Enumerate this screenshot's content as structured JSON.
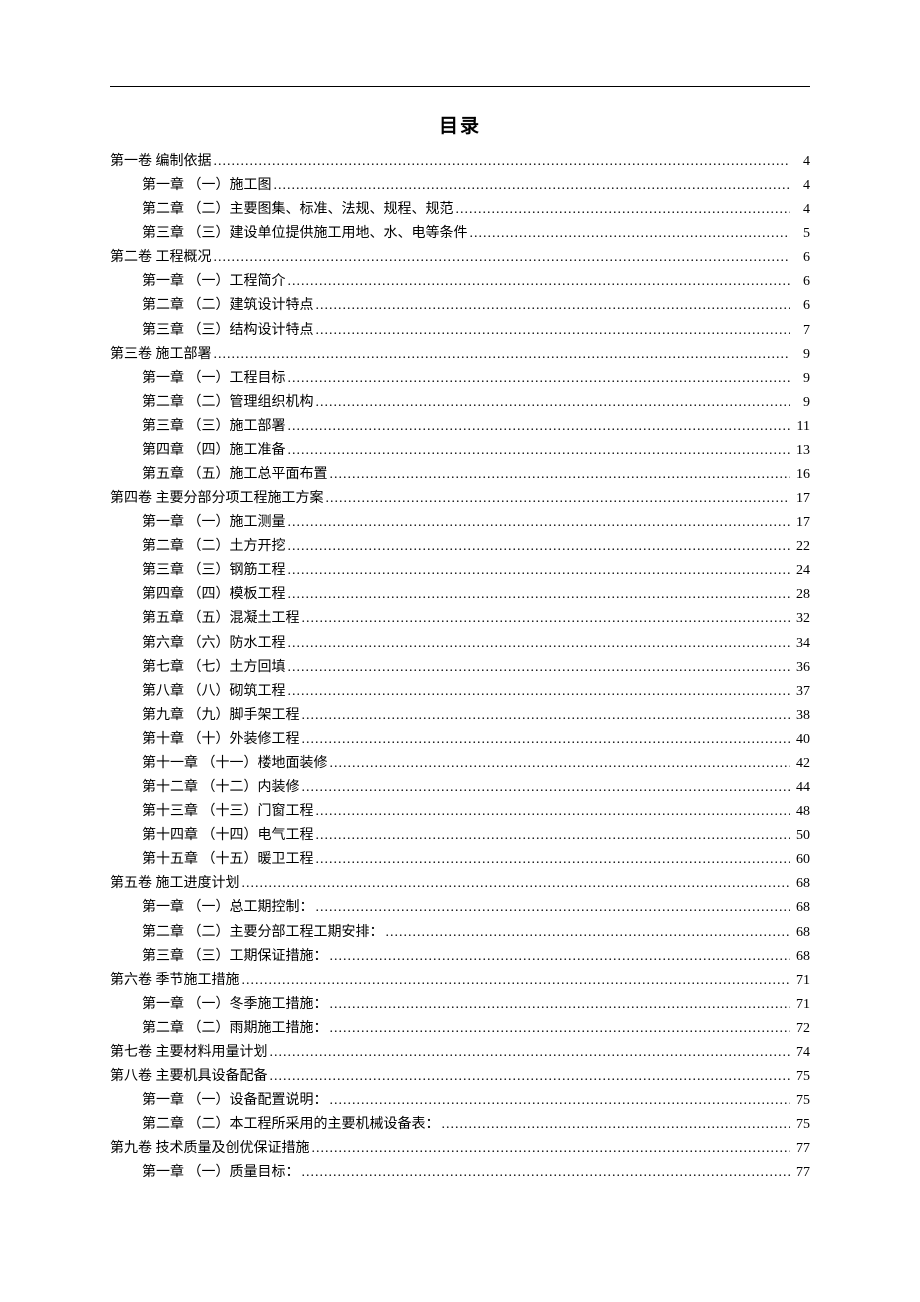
{
  "title": "目录",
  "entries": [
    {
      "level": 0,
      "label": "第一卷 编制依据",
      "page": "4"
    },
    {
      "level": 1,
      "label": "第一章 （一）施工图",
      "page": "4"
    },
    {
      "level": 1,
      "label": "第二章 （二）主要图集、标准、法规、规程、规范",
      "page": "4"
    },
    {
      "level": 1,
      "label": "第三章 （三）建设单位提供施工用地、水、电等条件",
      "page": "5"
    },
    {
      "level": 0,
      "label": "第二卷 工程概况",
      "page": "6"
    },
    {
      "level": 1,
      "label": "第一章 （一）工程简介",
      "page": "6"
    },
    {
      "level": 1,
      "label": "第二章 （二）建筑设计特点",
      "page": "6"
    },
    {
      "level": 1,
      "label": "第三章 （三）结构设计特点",
      "page": "7"
    },
    {
      "level": 0,
      "label": "第三卷 施工部署",
      "page": "9"
    },
    {
      "level": 1,
      "label": "第一章 （一）工程目标",
      "page": "9"
    },
    {
      "level": 1,
      "label": "第二章 （二）管理组织机构",
      "page": "9"
    },
    {
      "level": 1,
      "label": "第三章 （三）施工部署",
      "page": "11"
    },
    {
      "level": 1,
      "label": "第四章 （四）施工准备",
      "page": "13"
    },
    {
      "level": 1,
      "label": "第五章 （五）施工总平面布置",
      "page": "16"
    },
    {
      "level": 0,
      "label": "第四卷 主要分部分项工程施工方案",
      "page": "17"
    },
    {
      "level": 1,
      "label": "第一章 （一）施工测量",
      "page": "17"
    },
    {
      "level": 1,
      "label": "第二章 （二）土方开挖",
      "page": "22"
    },
    {
      "level": 1,
      "label": "第三章 （三）钢筋工程",
      "page": "24"
    },
    {
      "level": 1,
      "label": "第四章 （四）模板工程",
      "page": "28"
    },
    {
      "level": 1,
      "label": "第五章 （五）混凝土工程",
      "page": "32"
    },
    {
      "level": 1,
      "label": "第六章 （六）防水工程",
      "page": "34"
    },
    {
      "level": 1,
      "label": "第七章 （七）土方回填",
      "page": "36"
    },
    {
      "level": 1,
      "label": "第八章 （八）砌筑工程",
      "page": "37"
    },
    {
      "level": 1,
      "label": "第九章 （九）脚手架工程",
      "page": "38"
    },
    {
      "level": 1,
      "label": "第十章 （十）外装修工程",
      "page": "40"
    },
    {
      "level": 1,
      "label": "第十一章 （十一）楼地面装修",
      "page": "42"
    },
    {
      "level": 1,
      "label": "第十二章 （十二）内装修",
      "page": "44"
    },
    {
      "level": 1,
      "label": "第十三章 （十三）门窗工程",
      "page": "48"
    },
    {
      "level": 1,
      "label": "第十四章 （十四）电气工程",
      "page": "50"
    },
    {
      "level": 1,
      "label": "第十五章 （十五）暖卫工程",
      "page": "60"
    },
    {
      "level": 0,
      "label": "第五卷 施工进度计划",
      "page": "68"
    },
    {
      "level": 1,
      "label": "第一章 （一）总工期控制：",
      "page": "68"
    },
    {
      "level": 1,
      "label": "第二章 （二）主要分部工程工期安排：",
      "page": "68"
    },
    {
      "level": 1,
      "label": "第三章 （三）工期保证措施：",
      "page": "68"
    },
    {
      "level": 0,
      "label": "第六卷 季节施工措施",
      "page": "71"
    },
    {
      "level": 1,
      "label": "第一章 （一）冬季施工措施：",
      "page": "71"
    },
    {
      "level": 1,
      "label": "第二章 （二）雨期施工措施：",
      "page": "72"
    },
    {
      "level": 0,
      "label": "第七卷 主要材料用量计划",
      "page": "74"
    },
    {
      "level": 0,
      "label": "第八卷 主要机具设备配备",
      "page": "75"
    },
    {
      "level": 1,
      "label": "第一章 （一）设备配置说明：",
      "page": "75"
    },
    {
      "level": 1,
      "label": "第二章 （二）本工程所采用的主要机械设备表：",
      "page": "75"
    },
    {
      "level": 0,
      "label": "第九卷 技术质量及创优保证措施",
      "page": "77"
    },
    {
      "level": 1,
      "label": "第一章 （一）质量目标：",
      "page": "77"
    }
  ]
}
